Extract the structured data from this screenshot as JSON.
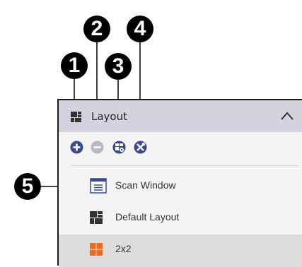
{
  "panel": {
    "title": "Layout",
    "header_icon": "layout-grid-icon",
    "collapse_icon": "chevron-up-icon",
    "toolbar": [
      {
        "icon": "add-circle-icon",
        "color": "#3c4a8a"
      },
      {
        "icon": "remove-circle-icon",
        "color": "#b6b8c4"
      },
      {
        "icon": "layout-settings-icon",
        "color": "#3c4a8a"
      },
      {
        "icon": "tools-icon",
        "color": "#3c4a8a"
      }
    ],
    "items": [
      {
        "label": "Scan Window",
        "icon": "window-icon"
      },
      {
        "label": "Default Layout",
        "icon": "layout-grid-icon"
      },
      {
        "label": "2x2",
        "icon": "grid-2x2-icon",
        "color": "#f26a1b",
        "selected": true
      }
    ]
  },
  "callouts": [
    "1",
    "2",
    "3",
    "4",
    "5"
  ]
}
